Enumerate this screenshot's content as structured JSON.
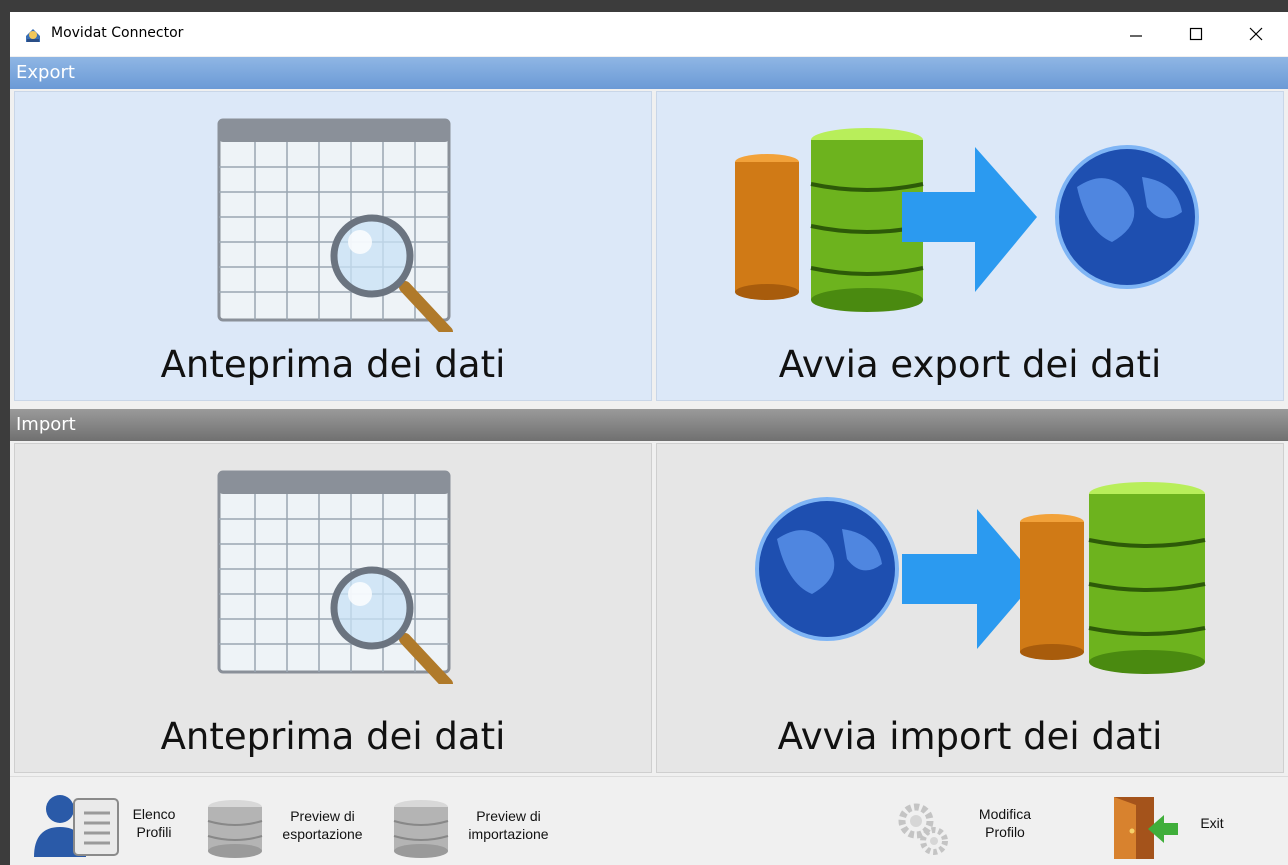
{
  "window": {
    "title": "Movidat Connector"
  },
  "export": {
    "header": "Export",
    "preview_label": "Anteprima dei dati",
    "run_label": "Avvia export dei dati"
  },
  "import": {
    "header": "Import",
    "preview_label": "Anteprima dei dati",
    "run_label": "Avvia import dei dati"
  },
  "toolbar": {
    "profiles_line1": "Elenco",
    "profiles_line2": "Profili",
    "export_preview_line1": "Preview di",
    "export_preview_line2": "esportazione",
    "import_preview_line1": "Preview di",
    "import_preview_line2": "importazione",
    "edit_profile_line1": "Modifica",
    "edit_profile_line2": "Profilo",
    "exit_label": "Exit"
  },
  "colors": {
    "export_header": "#7aa5dc",
    "import_header": "#858585",
    "export_tile": "#dce8f8",
    "import_tile": "#e6e6e6"
  }
}
